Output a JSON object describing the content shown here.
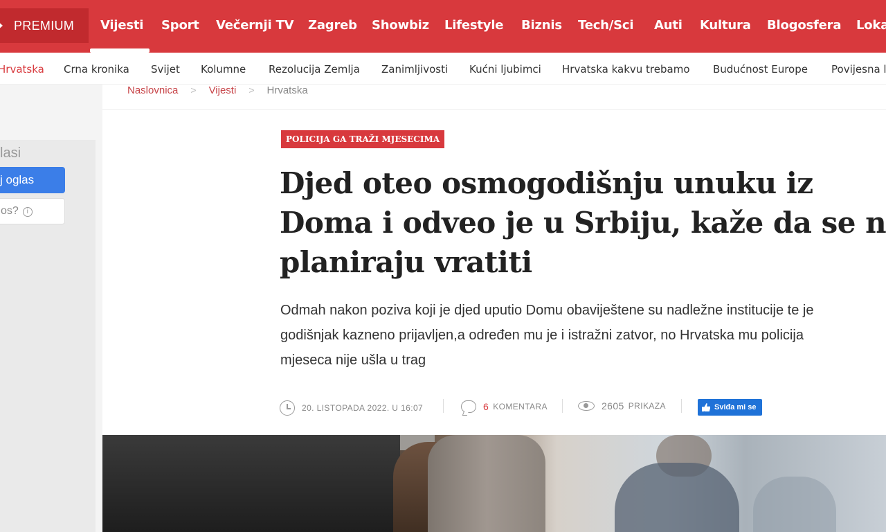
{
  "topnav": {
    "premium_label": "PREMIUM",
    "items": [
      "Vijesti",
      "Sport",
      "Večernji TV",
      "Zagreb",
      "Showbiz",
      "Lifestyle",
      "Biznis",
      "Tech/Sci",
      "Auti",
      "Kultura",
      "Blogosfera",
      "Loka"
    ],
    "active_item": "Vijesti",
    "background_color": "#d8393d"
  },
  "subnav": {
    "items": [
      "Hrvatska",
      "Crna kronika",
      "Svijet",
      "Kolumne",
      "Rezolucija Zemlja",
      "Zanimljivosti",
      "Kućni ljubimci",
      "Hrvatska kakvu trebamo",
      "Budućnost Europe",
      "Povijesna l"
    ],
    "active_item": "Hrvatska"
  },
  "sidebar": {
    "oglasi_label": "lasi",
    "ad_button": "j oglas",
    "question_label": "os?"
  },
  "breadcrumb": [
    "Naslovnica",
    "Vijesti",
    "Hrvatska"
  ],
  "article": {
    "kicker": "POLICIJA GA TRAŽI MJESECIMA",
    "headline_lines": [
      "Djed oteo osmogodišnju unuku iz",
      "Doma i odveo je u Srbiju, kaže da se ne",
      "planiraju vratiti"
    ],
    "lead_lines": [
      "Odmah nakon poziva koji je djed uputio Domu obaviještene su nadležne institucije te je",
      "godišnjak kazneno prijavljen,a određen mu je i istražni zatvor, no Hrvatska mu policija",
      "mjeseca nije ušla u trag"
    ],
    "date": "20. LISTOPADA 2022. U 16:07",
    "comments_count": "6",
    "comments_label": "KOMENTARA",
    "views_count": "2605",
    "views_label": "PRIKAZA",
    "like_button": "Sviđa mi se"
  },
  "icons": {
    "clock": "clock-icon",
    "comment": "comment-icon",
    "views": "eye-icon",
    "like": "thumbs-up-icon",
    "info": "info-icon"
  }
}
